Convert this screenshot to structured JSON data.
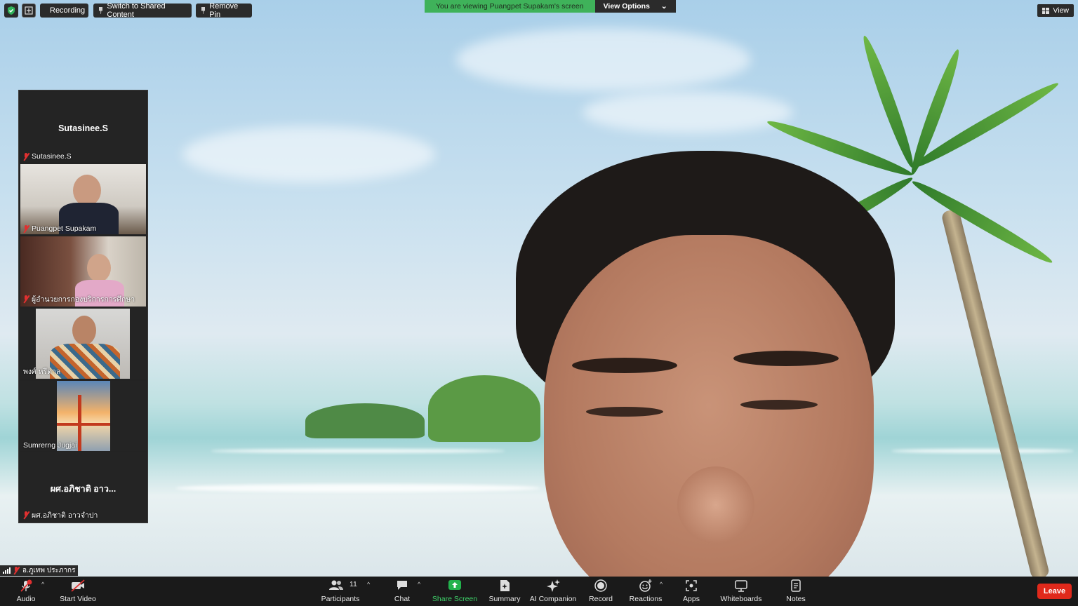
{
  "top": {
    "recording_label": "Recording",
    "switch_label": "Switch to Shared Content",
    "remove_pin_label": "Remove Pin",
    "viewing_text": "You are viewing Puangpet Supakam's screen",
    "view_options_label": "View Options",
    "view_label": "View"
  },
  "participants_panel": {
    "tiles": [
      {
        "display_name": "Sutasinee.S",
        "label": "Sutasinee.S",
        "muted": true,
        "video": false
      },
      {
        "label": "Puangpet Supakam",
        "muted": true,
        "video": true
      },
      {
        "label": "ผู้อำนวยการกองบริการการศึกษา",
        "muted": true,
        "video": true
      },
      {
        "label": "พงศ์ หรีดาล",
        "muted": false,
        "video": true
      },
      {
        "label": "Sumrerng Jugjai",
        "muted": false,
        "video": true
      },
      {
        "display_name": "ผศ.อภิชาติ  อาว...",
        "label": "ผศ.อภิชาติ  อาวจำปา",
        "muted": true,
        "video": false
      }
    ]
  },
  "self_view": {
    "label": "อ.ภูเทพ ประภากร"
  },
  "toolbar": {
    "audio": "Audio",
    "start_video": "Start Video",
    "participants": "Participants",
    "participants_count": "11",
    "chat": "Chat",
    "share_screen": "Share Screen",
    "summary": "Summary",
    "ai_companion": "AI Companion",
    "record": "Record",
    "reactions": "Reactions",
    "apps": "Apps",
    "whiteboards": "Whiteboards",
    "notes": "Notes",
    "leave": "Leave"
  },
  "colors": {
    "share_green": "#3fb25a",
    "leave_red": "#e0291b",
    "toolbar_bg": "#1a1a1a"
  }
}
